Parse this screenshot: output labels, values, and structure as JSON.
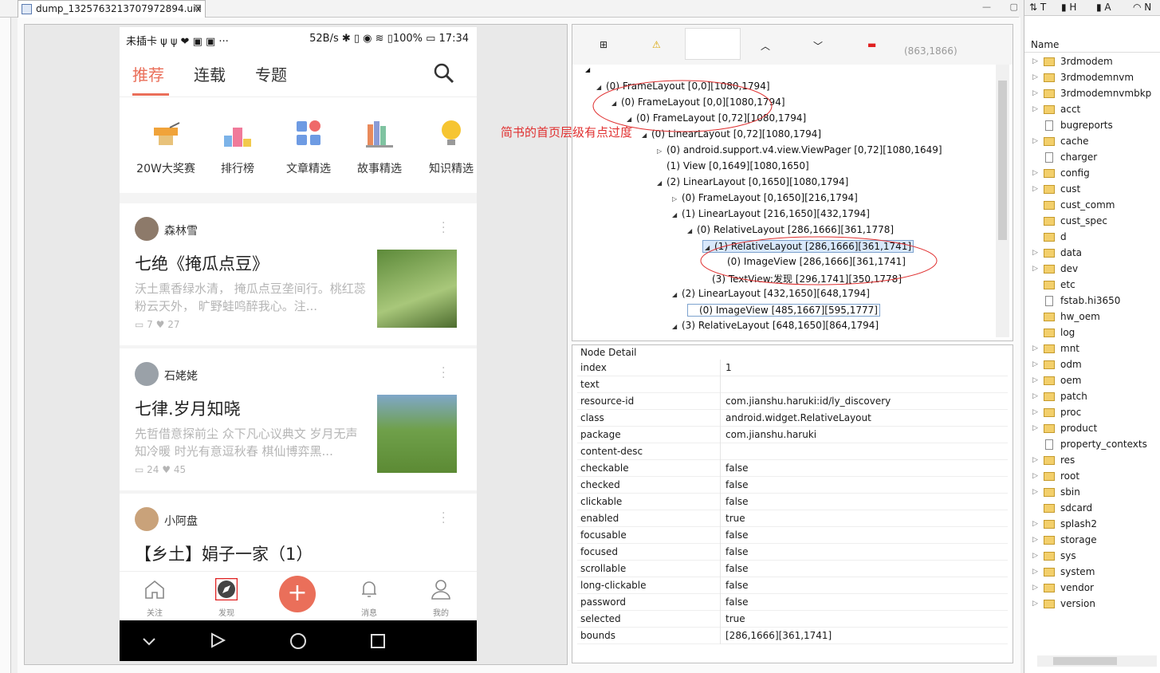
{
  "editor": {
    "tab_title": "dump_1325763213707972894.uix",
    "tab_close": "⊠"
  },
  "phone": {
    "status_left": "未插卡 ψ ψ ❤ ▣ ▣ ···",
    "status_right": "52B/s ✱ ▯ ◉ ≋ ▯100% ▭ 17:34",
    "tabs": [
      "推荐",
      "连载",
      "专题"
    ],
    "featured": [
      "20W大奖赛",
      "排行榜",
      "文章精选",
      "故事精选",
      "知识精选"
    ],
    "cards": [
      {
        "author": "森林雪",
        "title": "七绝《掩瓜点豆》",
        "excerpt": "沃土熏香绿水清， 掩瓜点豆垄间行。桃红蕊粉云天外， 旷野蛙鸣醉我心。注...",
        "comments": "7",
        "likes": "27"
      },
      {
        "author": "石姥姥",
        "title": "七律.岁月知晓",
        "excerpt": "先哲借意探前尘 众下凡心议典文 岁月无声知冷暖 时光有意逗秋春 棋仙博弈黑...",
        "comments": "24",
        "likes": "45"
      },
      {
        "author": "小阿盘",
        "title": "【乡土】娟子一家（1）",
        "excerpt": "",
        "comments": "",
        "likes": ""
      }
    ],
    "bottom_nav": [
      "关注",
      "发现",
      "消息",
      "我的"
    ],
    "fab": "+"
  },
  "toolbar": {
    "coords": "(863,1866)"
  },
  "annotation": "简书的首页层级有点过度",
  "tree": [
    {
      "label": "(0) FrameLayout [0,0][1080,1794]",
      "indent": 0,
      "twisty": "◢"
    },
    {
      "label": "(0) FrameLayout [0,0][1080,1794]",
      "indent": 1,
      "twisty": "◢"
    },
    {
      "label": "(0) FrameLayout [0,72][1080,1794]",
      "indent": 2,
      "twisty": "◢"
    },
    {
      "label": "(0) LinearLayout [0,72][1080,1794]",
      "indent": 3,
      "twisty": "◢"
    },
    {
      "label": "(0) android.support.v4.view.ViewPager [0,72][1080,1649]",
      "indent": 4,
      "twisty": "▷"
    },
    {
      "label": "(1) View [0,1649][1080,1650]",
      "indent": 4,
      "twisty": ""
    },
    {
      "label": "(2) LinearLayout [0,1650][1080,1794]",
      "indent": 4,
      "twisty": "◢"
    },
    {
      "label": "(0) FrameLayout [0,1650][216,1794]",
      "indent": 5,
      "twisty": "▷"
    },
    {
      "label": "(1) LinearLayout [216,1650][432,1794]",
      "indent": 5,
      "twisty": "◢"
    },
    {
      "label": "(0) RelativeLayout [286,1666][361,1778]",
      "indent": 6,
      "twisty": "◢"
    },
    {
      "label": "(1) RelativeLayout [286,1666][361,1741]",
      "indent": 7,
      "twisty": "◢",
      "selected": true
    },
    {
      "label": "(0) ImageView [286,1666][361,1741]",
      "indent": 8,
      "twisty": ""
    },
    {
      "label": "(3) TextView:发现 [296,1741][350,1778]",
      "indent": 7,
      "twisty": ""
    },
    {
      "label": "(2) LinearLayout [432,1650][648,1794]",
      "indent": 5,
      "twisty": "◢"
    },
    {
      "label": "(0) ImageView [485,1667][595,1777]",
      "indent": 6,
      "twisty": "",
      "boxed": true
    },
    {
      "label": "(3) RelativeLayout [648,1650][864,1794]",
      "indent": 5,
      "twisty": "◢"
    }
  ],
  "detail": {
    "title": "Node Detail",
    "rows": [
      {
        "k": "index",
        "v": "1"
      },
      {
        "k": "text",
        "v": ""
      },
      {
        "k": "resource-id",
        "v": "com.jianshu.haruki:id/ly_discovery"
      },
      {
        "k": "class",
        "v": "android.widget.RelativeLayout"
      },
      {
        "k": "package",
        "v": "com.jianshu.haruki"
      },
      {
        "k": "content-desc",
        "v": ""
      },
      {
        "k": "checkable",
        "v": "false"
      },
      {
        "k": "checked",
        "v": "false"
      },
      {
        "k": "clickable",
        "v": "false"
      },
      {
        "k": "enabled",
        "v": "true"
      },
      {
        "k": "focusable",
        "v": "false"
      },
      {
        "k": "focused",
        "v": "false"
      },
      {
        "k": "scrollable",
        "v": "false"
      },
      {
        "k": "long-clickable",
        "v": "false"
      },
      {
        "k": "password",
        "v": "false"
      },
      {
        "k": "selected",
        "v": "true"
      },
      {
        "k": "bounds",
        "v": "[286,1666][361,1741]"
      }
    ]
  },
  "right": {
    "tabs": [
      "T",
      "H",
      "A",
      "N"
    ],
    "header": "Name",
    "items": [
      {
        "n": "3rdmodem",
        "t": "d"
      },
      {
        "n": "3rdmodemnvm",
        "t": "d"
      },
      {
        "n": "3rdmodemnvmbkp",
        "t": "d"
      },
      {
        "n": "acct",
        "t": "d"
      },
      {
        "n": "bugreports",
        "t": "f"
      },
      {
        "n": "cache",
        "t": "d"
      },
      {
        "n": "charger",
        "t": "f"
      },
      {
        "n": "config",
        "t": "d"
      },
      {
        "n": "cust",
        "t": "d"
      },
      {
        "n": "cust_comm",
        "t": "e"
      },
      {
        "n": "cust_spec",
        "t": "e"
      },
      {
        "n": "d",
        "t": "e"
      },
      {
        "n": "data",
        "t": "d"
      },
      {
        "n": "dev",
        "t": "d"
      },
      {
        "n": "etc",
        "t": "e"
      },
      {
        "n": "fstab.hi3650",
        "t": "f"
      },
      {
        "n": "hw_oem",
        "t": "e"
      },
      {
        "n": "log",
        "t": "e"
      },
      {
        "n": "mnt",
        "t": "d"
      },
      {
        "n": "odm",
        "t": "d"
      },
      {
        "n": "oem",
        "t": "d"
      },
      {
        "n": "patch",
        "t": "d"
      },
      {
        "n": "proc",
        "t": "d"
      },
      {
        "n": "product",
        "t": "d"
      },
      {
        "n": "property_contexts",
        "t": "f"
      },
      {
        "n": "res",
        "t": "d"
      },
      {
        "n": "root",
        "t": "d"
      },
      {
        "n": "sbin",
        "t": "d"
      },
      {
        "n": "sdcard",
        "t": "e"
      },
      {
        "n": "splash2",
        "t": "d"
      },
      {
        "n": "storage",
        "t": "d"
      },
      {
        "n": "sys",
        "t": "d"
      },
      {
        "n": "system",
        "t": "d"
      },
      {
        "n": "vendor",
        "t": "d"
      },
      {
        "n": "version",
        "t": "d"
      }
    ]
  },
  "colors": {
    "accent": "#ea6f5a",
    "annotation": "#e03030",
    "selection": "#d9e8fb"
  }
}
